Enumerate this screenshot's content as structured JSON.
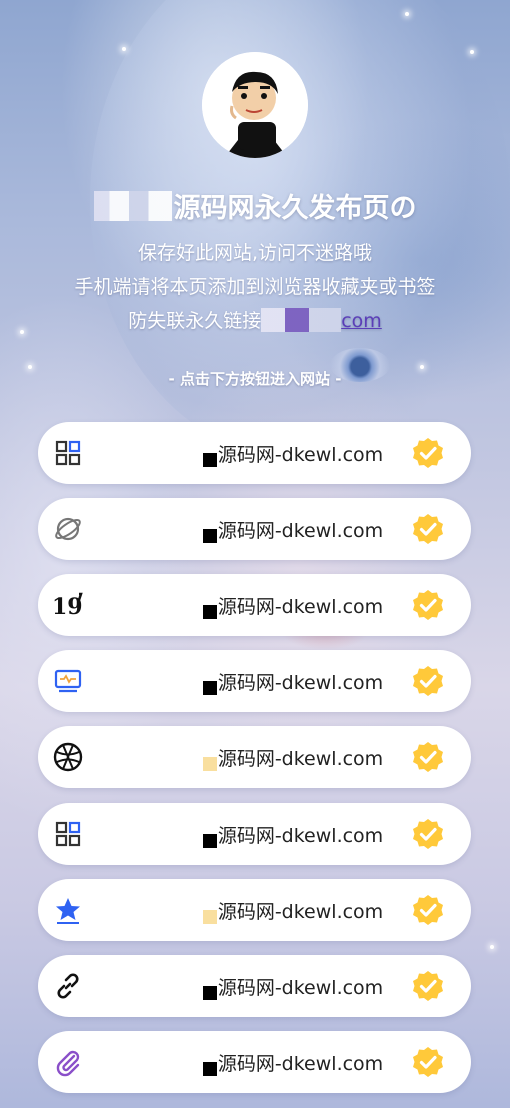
{
  "header": {
    "title": "源码网永久发布页の",
    "line1": "保存好此网站,访问不迷路哦",
    "line2": "手机端请将本页添加到浏览器收藏夹或书签",
    "line3_prefix": "防失联永久链接",
    "line3_link": "com",
    "cta": "- 点击下方按钮进入网站 -"
  },
  "links": [
    {
      "icon": "grid-apps-icon",
      "label": "源码网-dkewl.com",
      "mark_color": "#000000"
    },
    {
      "icon": "planet-icon",
      "label": "源码网-dkewl.com",
      "mark_color": "#000000"
    },
    {
      "icon": "number-19-icon",
      "label": "源码网-dkewl.com",
      "mark_color": "#000000"
    },
    {
      "icon": "monitor-pulse-icon",
      "label": "源码网-dkewl.com",
      "mark_color": "#000000"
    },
    {
      "icon": "globe-icon",
      "label": "源码网-dkewl.com",
      "mark_color": "#f9df9f"
    },
    {
      "icon": "grid-apps-icon",
      "label": "源码网-dkewl.com",
      "mark_color": "#000000"
    },
    {
      "icon": "star-icon",
      "label": "源码网-dkewl.com",
      "mark_color": "#f9df9f"
    },
    {
      "icon": "link-icon",
      "label": "源码网-dkewl.com",
      "mark_color": "#000000"
    },
    {
      "icon": "paperclip-icon",
      "label": "源码网-dkewl.com",
      "mark_color": "#000000"
    }
  ],
  "colors": {
    "accent": "#2f62f2",
    "check": "#ffc93a",
    "link": "#5b3fb8"
  }
}
